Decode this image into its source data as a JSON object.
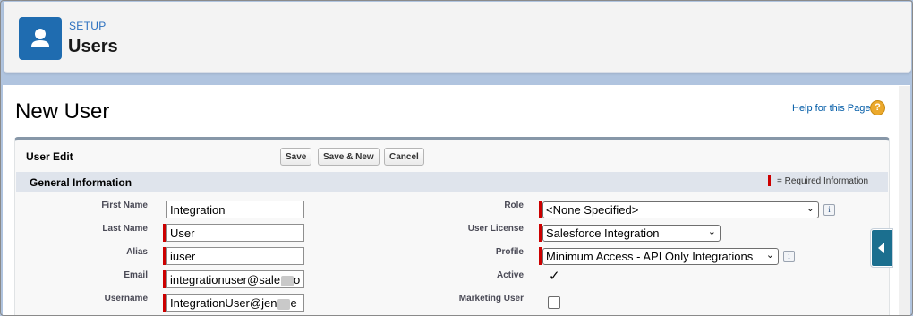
{
  "header": {
    "eyebrow": "SETUP",
    "title": "Users",
    "icon": "user-icon",
    "accent_color": "#1f6cb0"
  },
  "page": {
    "title": "New User",
    "help_link": "Help for this Page",
    "help_icon": "?"
  },
  "panel": {
    "title": "User Edit",
    "buttons": {
      "save": "Save",
      "save_new": "Save & New",
      "cancel": "Cancel"
    }
  },
  "section": {
    "title": "General Information",
    "required_legend": "= Required Information",
    "required_color": "#cc0000"
  },
  "left_fields": [
    {
      "label": "First Name",
      "value": "Integration",
      "required": false
    },
    {
      "label": "Last Name",
      "value": "User",
      "required": true
    },
    {
      "label": "Alias",
      "value": "iuser",
      "required": true
    },
    {
      "label": "Email",
      "value": "integrationuser@sale",
      "value_tail": "o",
      "required": true
    },
    {
      "label": "Username",
      "value": "IntegrationUser@jen",
      "value_tail": "e",
      "required": true
    }
  ],
  "right_fields": {
    "role": {
      "label": "Role",
      "selected": "<None Specified>",
      "info": "i"
    },
    "user_license": {
      "label": "User License",
      "selected": "Salesforce Integration"
    },
    "profile": {
      "label": "Profile",
      "selected": "Minimum Access - API Only Integrations",
      "info": "i"
    },
    "active": {
      "label": "Active",
      "checked": true,
      "check_glyph": "✓"
    },
    "marketing_user": {
      "label": "Marketing User",
      "checked": false
    }
  },
  "side_panel": {
    "icon": "collapse-arrow-icon"
  }
}
